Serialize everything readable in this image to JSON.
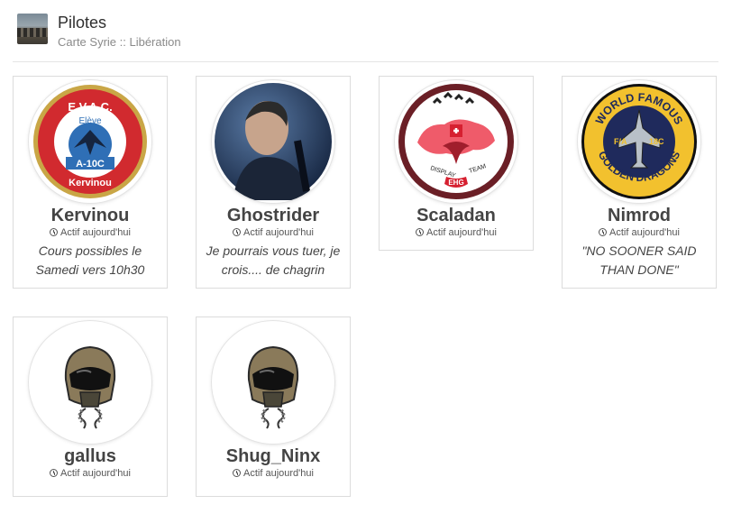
{
  "header": {
    "title": "Pilotes",
    "subtitle": "Carte Syrie :: Libération"
  },
  "members": [
    {
      "name": "Kervinou",
      "status": "Actif aujourd'hui",
      "bio": "Cours possibles le Samedi vers 10h30",
      "avatar": "evac-a10c-badge"
    },
    {
      "name": "Ghostrider",
      "status": "Actif aujourd'hui",
      "bio": "Je pourrais vous tuer, je crois.... de chagrin",
      "avatar": "portrait-photo"
    },
    {
      "name": "Scaladan",
      "status": "Actif aujourd'hui",
      "bio": "",
      "avatar": "display-team-badge",
      "badge_text": {
        "left": "DISPLAY",
        "right": "TEAM",
        "bottom": "EHG"
      }
    },
    {
      "name": "Nimrod",
      "status": "Actif aujourd'hui",
      "bio": "\"NO SOONER SAID THAN DONE\"",
      "avatar": "golden-dragons-badge",
      "badge_text": {
        "top": "WORLD FAMOUS",
        "bottom": "GOLDEN DRAGONS",
        "left": "F/A",
        "right": "18C"
      }
    },
    {
      "name": "gallus",
      "status": "Actif aujourd'hui",
      "bio": "",
      "avatar": "pilot-helmet-icon"
    },
    {
      "name": "Shug_Ninx",
      "status": "Actif aujourd'hui",
      "bio": "",
      "avatar": "pilot-helmet-icon"
    }
  ],
  "badge_kervinou": {
    "top": "E.V.A.C.",
    "mid": "Elève",
    "type": "A-10C",
    "bottom": "Kervinou"
  },
  "colors": {
    "accent": "#c8242b",
    "navy": "#1f2a5c",
    "gold": "#f2c12e"
  }
}
